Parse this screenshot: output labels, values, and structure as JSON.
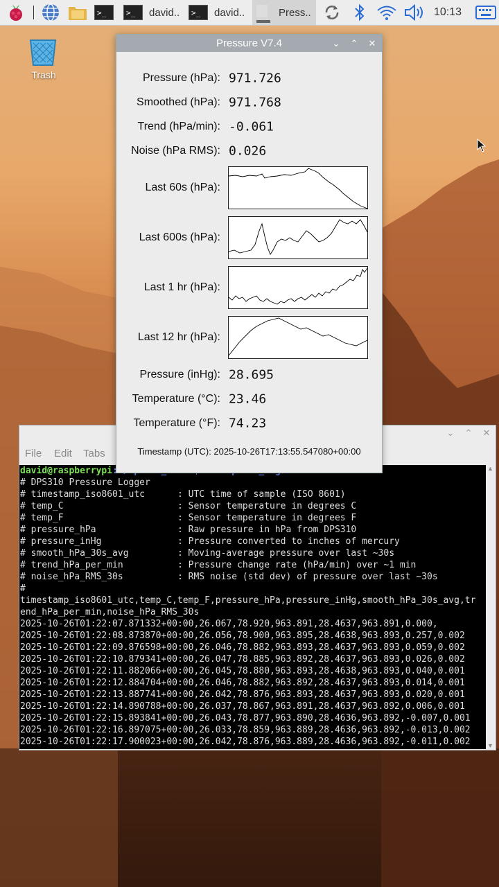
{
  "taskbar": {
    "clock": "10:13",
    "tasks": [
      {
        "label": "david.."
      },
      {
        "label": "david.."
      },
      {
        "label": "Press.."
      }
    ]
  },
  "desktop": {
    "trash_label": "Trash"
  },
  "pressure_window": {
    "title": "Pressure V7.4",
    "rows": [
      {
        "label": "Pressure (hPa):",
        "value": "971.726"
      },
      {
        "label": "Smoothed (hPa):",
        "value": "971.768"
      },
      {
        "label": "Trend (hPa/min):",
        "value": "-0.061"
      },
      {
        "label": "Noise (hPa RMS):",
        "value": "0.026"
      }
    ],
    "charts": [
      {
        "label": "Last 60s (hPa):"
      },
      {
        "label": "Last 600s (hPa):"
      },
      {
        "label": "Last 1 hr (hPa):"
      },
      {
        "label": "Last 12 hr (hPa):"
      }
    ],
    "rows2": [
      {
        "label": "Pressure (inHg):",
        "value": "28.695"
      },
      {
        "label": "Temperature (°C):",
        "value": "23.46"
      },
      {
        "label": "Temperature (°F):",
        "value": "74.23"
      }
    ],
    "timestamp": "Timestamp (UTC): 2025-10-26T17:13:55.547080+00:00"
  },
  "terminal": {
    "menu": [
      "File",
      "Edit",
      "Tabs"
    ],
    "prompt_user": "david@raspberrypi",
    "prompt_rest": ":~/dps310_test $ cat dps310_log.csv",
    "lines": [
      "# DPS310 Pressure Logger",
      "# timestamp_iso8601_utc      : UTC time of sample (ISO 8601)",
      "# temp_C                     : Sensor temperature in degrees C",
      "# temp_F                     : Sensor temperature in degrees F",
      "# pressure_hPa               : Raw pressure in hPa from DPS310",
      "# pressure_inHg              : Pressure converted to inches of mercury",
      "# smooth_hPa_30s_avg         : Moving-average pressure over last ~30s",
      "# trend_hPa_per_min          : Pressure change rate (hPa/min) over ~1 min",
      "# noise_hPa_RMS_30s          : RMS noise (std dev) of pressure over last ~30s",
      "#",
      "timestamp_iso8601_utc,temp_C,temp_F,pressure_hPa,pressure_inHg,smooth_hPa_30s_avg,tr",
      "end_hPa_per_min,noise_hPa_RMS_30s",
      "2025-10-26T01:22:07.871332+00:00,26.067,78.920,963.891,28.4637,963.891,0.000,",
      "2025-10-26T01:22:08.873870+00:00,26.056,78.900,963.895,28.4638,963.893,0.257,0.002",
      "2025-10-26T01:22:09.876598+00:00,26.046,78.882,963.893,28.4637,963.893,0.059,0.002",
      "2025-10-26T01:22:10.879341+00:00,26.047,78.885,963.892,28.4637,963.893,0.026,0.002",
      "2025-10-26T01:22:11.882066+00:00,26.045,78.880,963.893,28.4638,963.893,0.040,0.001",
      "2025-10-26T01:22:12.884704+00:00,26.046,78.882,963.892,28.4637,963.893,0.014,0.001",
      "2025-10-26T01:22:13.887741+00:00,26.042,78.876,963.893,28.4637,963.893,0.020,0.001",
      "2025-10-26T01:22:14.890788+00:00,26.037,78.867,963.891,28.4637,963.892,0.006,0.001",
      "2025-10-26T01:22:15.893841+00:00,26.043,78.877,963.890,28.4636,963.892,-0.007,0.001",
      "2025-10-26T01:22:16.897075+00:00,26.033,78.859,963.889,28.4636,963.892,-0.013,0.002",
      "2025-10-26T01:22:17.900023+00:00,26.042,78.876,963.889,28.4636,963.892,-0.011,0.002"
    ]
  },
  "colors": {
    "taskbar_bg": "#ededed",
    "window_title": "#a4aab0",
    "terminal_bg": "#000000",
    "prompt_green": "#7fe05a",
    "prompt_blue": "#6b8cff"
  }
}
